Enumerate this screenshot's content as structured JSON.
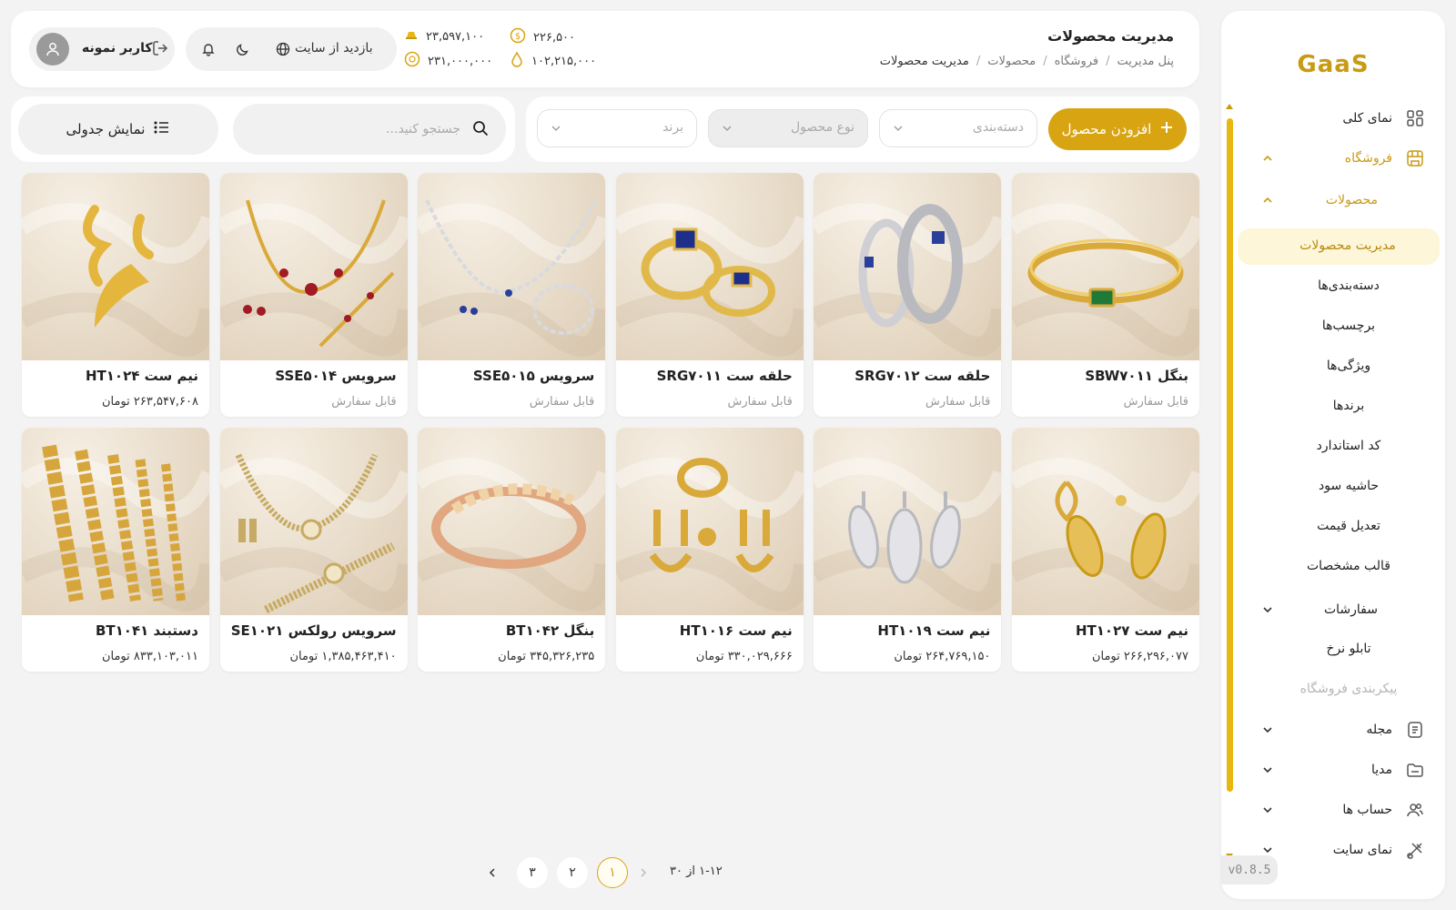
{
  "app": {
    "logo": "GaaS",
    "version": "v0.8.5"
  },
  "colors": {
    "accent": "#d9a412",
    "accent_text": "#c99a14",
    "selected_bg": "#fdf6d8"
  },
  "header": {
    "title": "مدیریت محصولات",
    "breadcrumb": [
      "پنل مدیریت",
      "فروشگاه",
      "محصولات",
      "مدیریت محصولات"
    ],
    "prices": [
      {
        "value": "۲۲۶,۵۰۰",
        "icon": "dollar-coin-icon"
      },
      {
        "value": "۲۳,۵۹۷,۱۰۰",
        "icon": "gold-bar-icon"
      },
      {
        "value": "۱۰۲,۲۱۵,۰۰۰",
        "icon": "drop-icon"
      },
      {
        "value": "۲۳۱,۰۰۰,۰۰۰",
        "icon": "coin-icon"
      }
    ],
    "visit_site": "بازدید از سایت",
    "user_name": "کاربر نمونه"
  },
  "filters": {
    "add_product": "افزودن محصول",
    "category_placeholder": "دسته‌بندی",
    "type_placeholder": "نوع محصول",
    "brand_placeholder": "برند"
  },
  "search": {
    "placeholder": "جستجو کنید...",
    "value": ""
  },
  "view_toggle": "نمایش جدولی",
  "sidebar": {
    "overview": "نمای کلی",
    "store": "فروشگاه",
    "products": "محصولات",
    "sub_items": [
      "مدیریت محصولات",
      "دسته‌بندی‌ها",
      "برچسب‌ها",
      "ویژگی‌ها",
      "برندها",
      "کد استاندارد",
      "حاشیه سود",
      "تعدیل قیمت",
      "قالب مشخصات"
    ],
    "orders": "سفارشات",
    "rate_board": "تابلو نرخ",
    "store_config": "پیکربندی فروشگاه",
    "magazine": "مجله",
    "media": "مدیا",
    "accounts": "حساب ها",
    "site_view": "نمای سایت"
  },
  "products": [
    {
      "name": "بنگل SBW۷۰۱۱",
      "meta": "قابل سفارش",
      "kind": "bangle-emerald"
    },
    {
      "name": "حلقه ست SRG۷۰۱۲",
      "meta": "قابل سفارش",
      "kind": "rings-silver"
    },
    {
      "name": "حلقه ست SRG۷۰۱۱",
      "meta": "قابل سفارش",
      "kind": "rings-gold"
    },
    {
      "name": "سرویس SSE۵۰۱۵",
      "meta": "قابل سفارش",
      "kind": "set-silver"
    },
    {
      "name": "سرویس SSE۵۰۱۴",
      "meta": "قابل سفارش",
      "kind": "set-ruby"
    },
    {
      "name": "نیم ست HT۱۰۲۴",
      "meta": "۲۶۳,۵۴۷,۶۰۸ تومان",
      "kind": "earrings-wave"
    },
    {
      "name": "نیم ست HT۱۰۲۷",
      "meta": "۲۶۶,۲۹۶,۰۷۷ تومان",
      "kind": "earrings-leaf-gold"
    },
    {
      "name": "نیم ست HT۱۰۱۹",
      "meta": "۲۶۴,۷۶۹,۱۵۰ تومان",
      "kind": "earrings-leaf-silver"
    },
    {
      "name": "نیم ست HT۱۰۱۶",
      "meta": "۳۳۰,۰۲۹,۶۶۶ تومان",
      "kind": "earrings-hook"
    },
    {
      "name": "بنگل BT۱۰۴۲",
      "meta": "۳۴۵,۳۲۶,۲۳۵ تومان",
      "kind": "bangle-rose"
    },
    {
      "name": "سرویس رولکس SE۱۰۲۱",
      "meta": "۱,۳۸۵,۴۶۳,۴۱۰ تومان",
      "kind": "set-rolex"
    },
    {
      "name": "دستبند BT۱۰۴۱",
      "meta": "۸۳۳,۱۰۳,۰۱۱ تومان",
      "kind": "bracelets-chain"
    }
  ],
  "pagination": {
    "range": "۱-۱۲ از ۳۰",
    "pages": [
      "۱",
      "۲",
      "۳"
    ],
    "current": "۱"
  }
}
